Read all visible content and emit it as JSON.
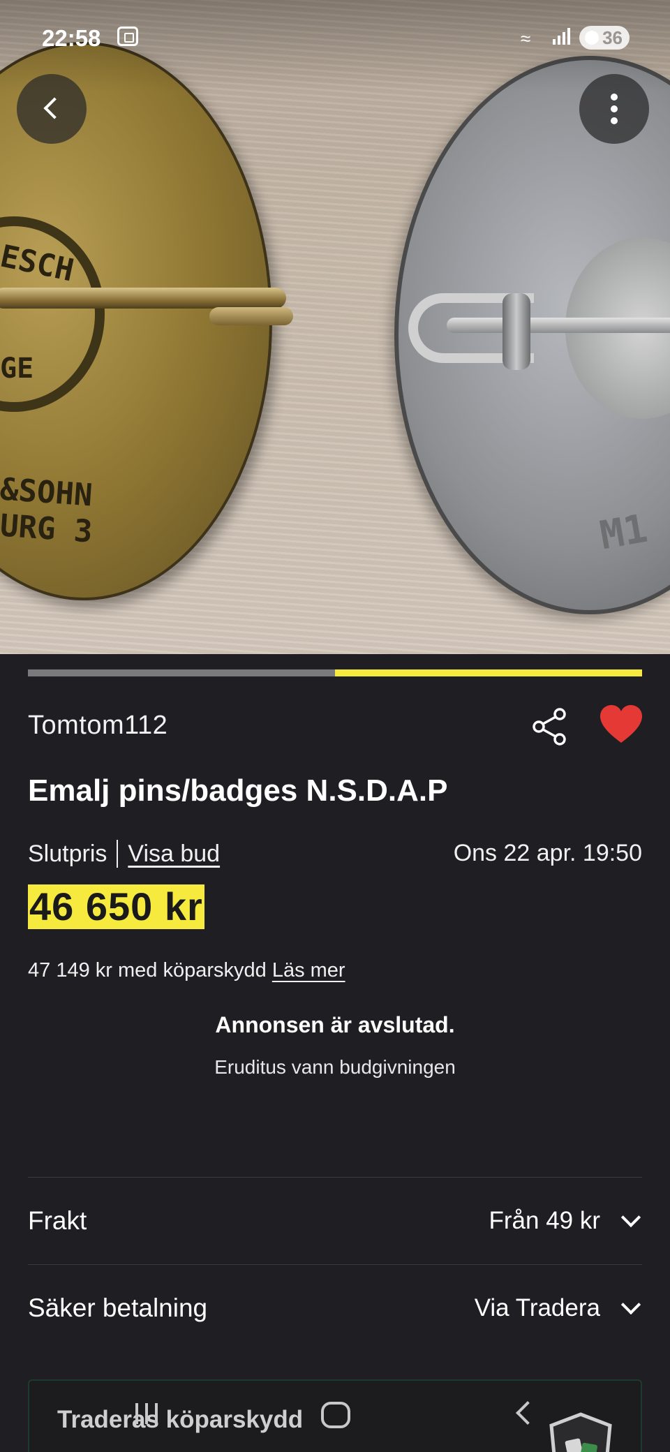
{
  "status_bar": {
    "time": "22:58",
    "battery": "36"
  },
  "hero": {
    "badge_left_text_1": "ESCH",
    "badge_left_text_2": "GE",
    "badge_left_text_3": "&SOHN",
    "badge_left_text_4": "URG 3",
    "badge_right_text": "M1"
  },
  "gallery": {
    "progress": 0.5
  },
  "listing": {
    "seller": "Tomtom112",
    "title": "Emalj pins/badges N.S.D.A.P",
    "price_label": "Slutpris",
    "bids_link": "Visa bud",
    "end_date": "Ons 22 apr. 19:50",
    "price": "46 650 kr",
    "buyer_protection_price": "47 149 kr med köparskydd",
    "read_more": "Läs mer",
    "closed_title": "Annonsen är avslutad.",
    "closed_subtitle": "Eruditus vann budgivningen"
  },
  "shipping": {
    "label": "Frakt",
    "value": "Från 49 kr"
  },
  "payment": {
    "label": "Säker betalning",
    "value": "Via Tradera"
  },
  "protection_card": {
    "title": "Traderas köparskydd"
  },
  "colors": {
    "accent_yellow": "#f6ea3f",
    "heart_red": "#e53935",
    "background": "#1f1f23"
  },
  "icons": [
    "back-arrow-icon",
    "more-vertical-icon",
    "share-icon",
    "heart-icon",
    "chevron-down-icon",
    "shield-icon"
  ]
}
